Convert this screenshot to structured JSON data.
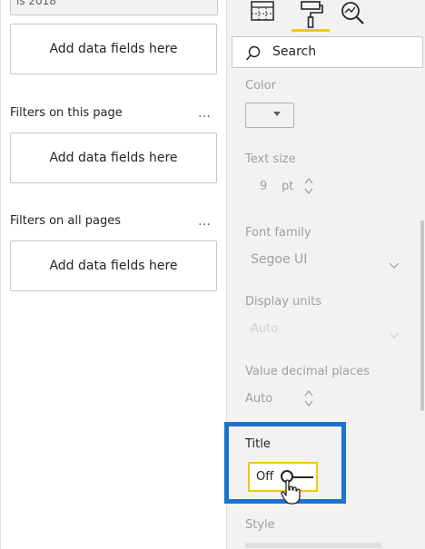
{
  "filters_pane": {
    "top_filter_partial_text": "is 2018",
    "top_drop_label": "Add data fields here",
    "page_section": {
      "label": "Filters on this page",
      "more": "…",
      "drop_label": "Add data fields here"
    },
    "all_section": {
      "label": "Filters on all pages",
      "more": "…",
      "drop_label": "Add data fields here"
    }
  },
  "format_pane": {
    "tabs": [
      {
        "name": "fields-tab",
        "icon": "table-grid-icon"
      },
      {
        "name": "format-tab",
        "icon": "paint-roller-icon",
        "active": true
      },
      {
        "name": "analytics-tab",
        "icon": "magnifier-chart-icon"
      }
    ],
    "search_placeholder": "Search",
    "properties": {
      "color_label": "Color",
      "text_size_label": "Text size",
      "text_size_value": "9",
      "text_size_unit": "pt",
      "font_family_label": "Font family",
      "font_family_value": "Segoe UI",
      "display_units_label": "Display units",
      "display_units_value": "Auto",
      "decimal_places_label": "Value decimal places",
      "decimal_places_value": "Auto",
      "title_label": "Title",
      "title_toggle_value": "Off",
      "style_label": "Style"
    }
  },
  "colors": {
    "accent_underline": "#f2c811",
    "highlight_border": "#1a73cf",
    "toggle_border": "#f2c811"
  }
}
